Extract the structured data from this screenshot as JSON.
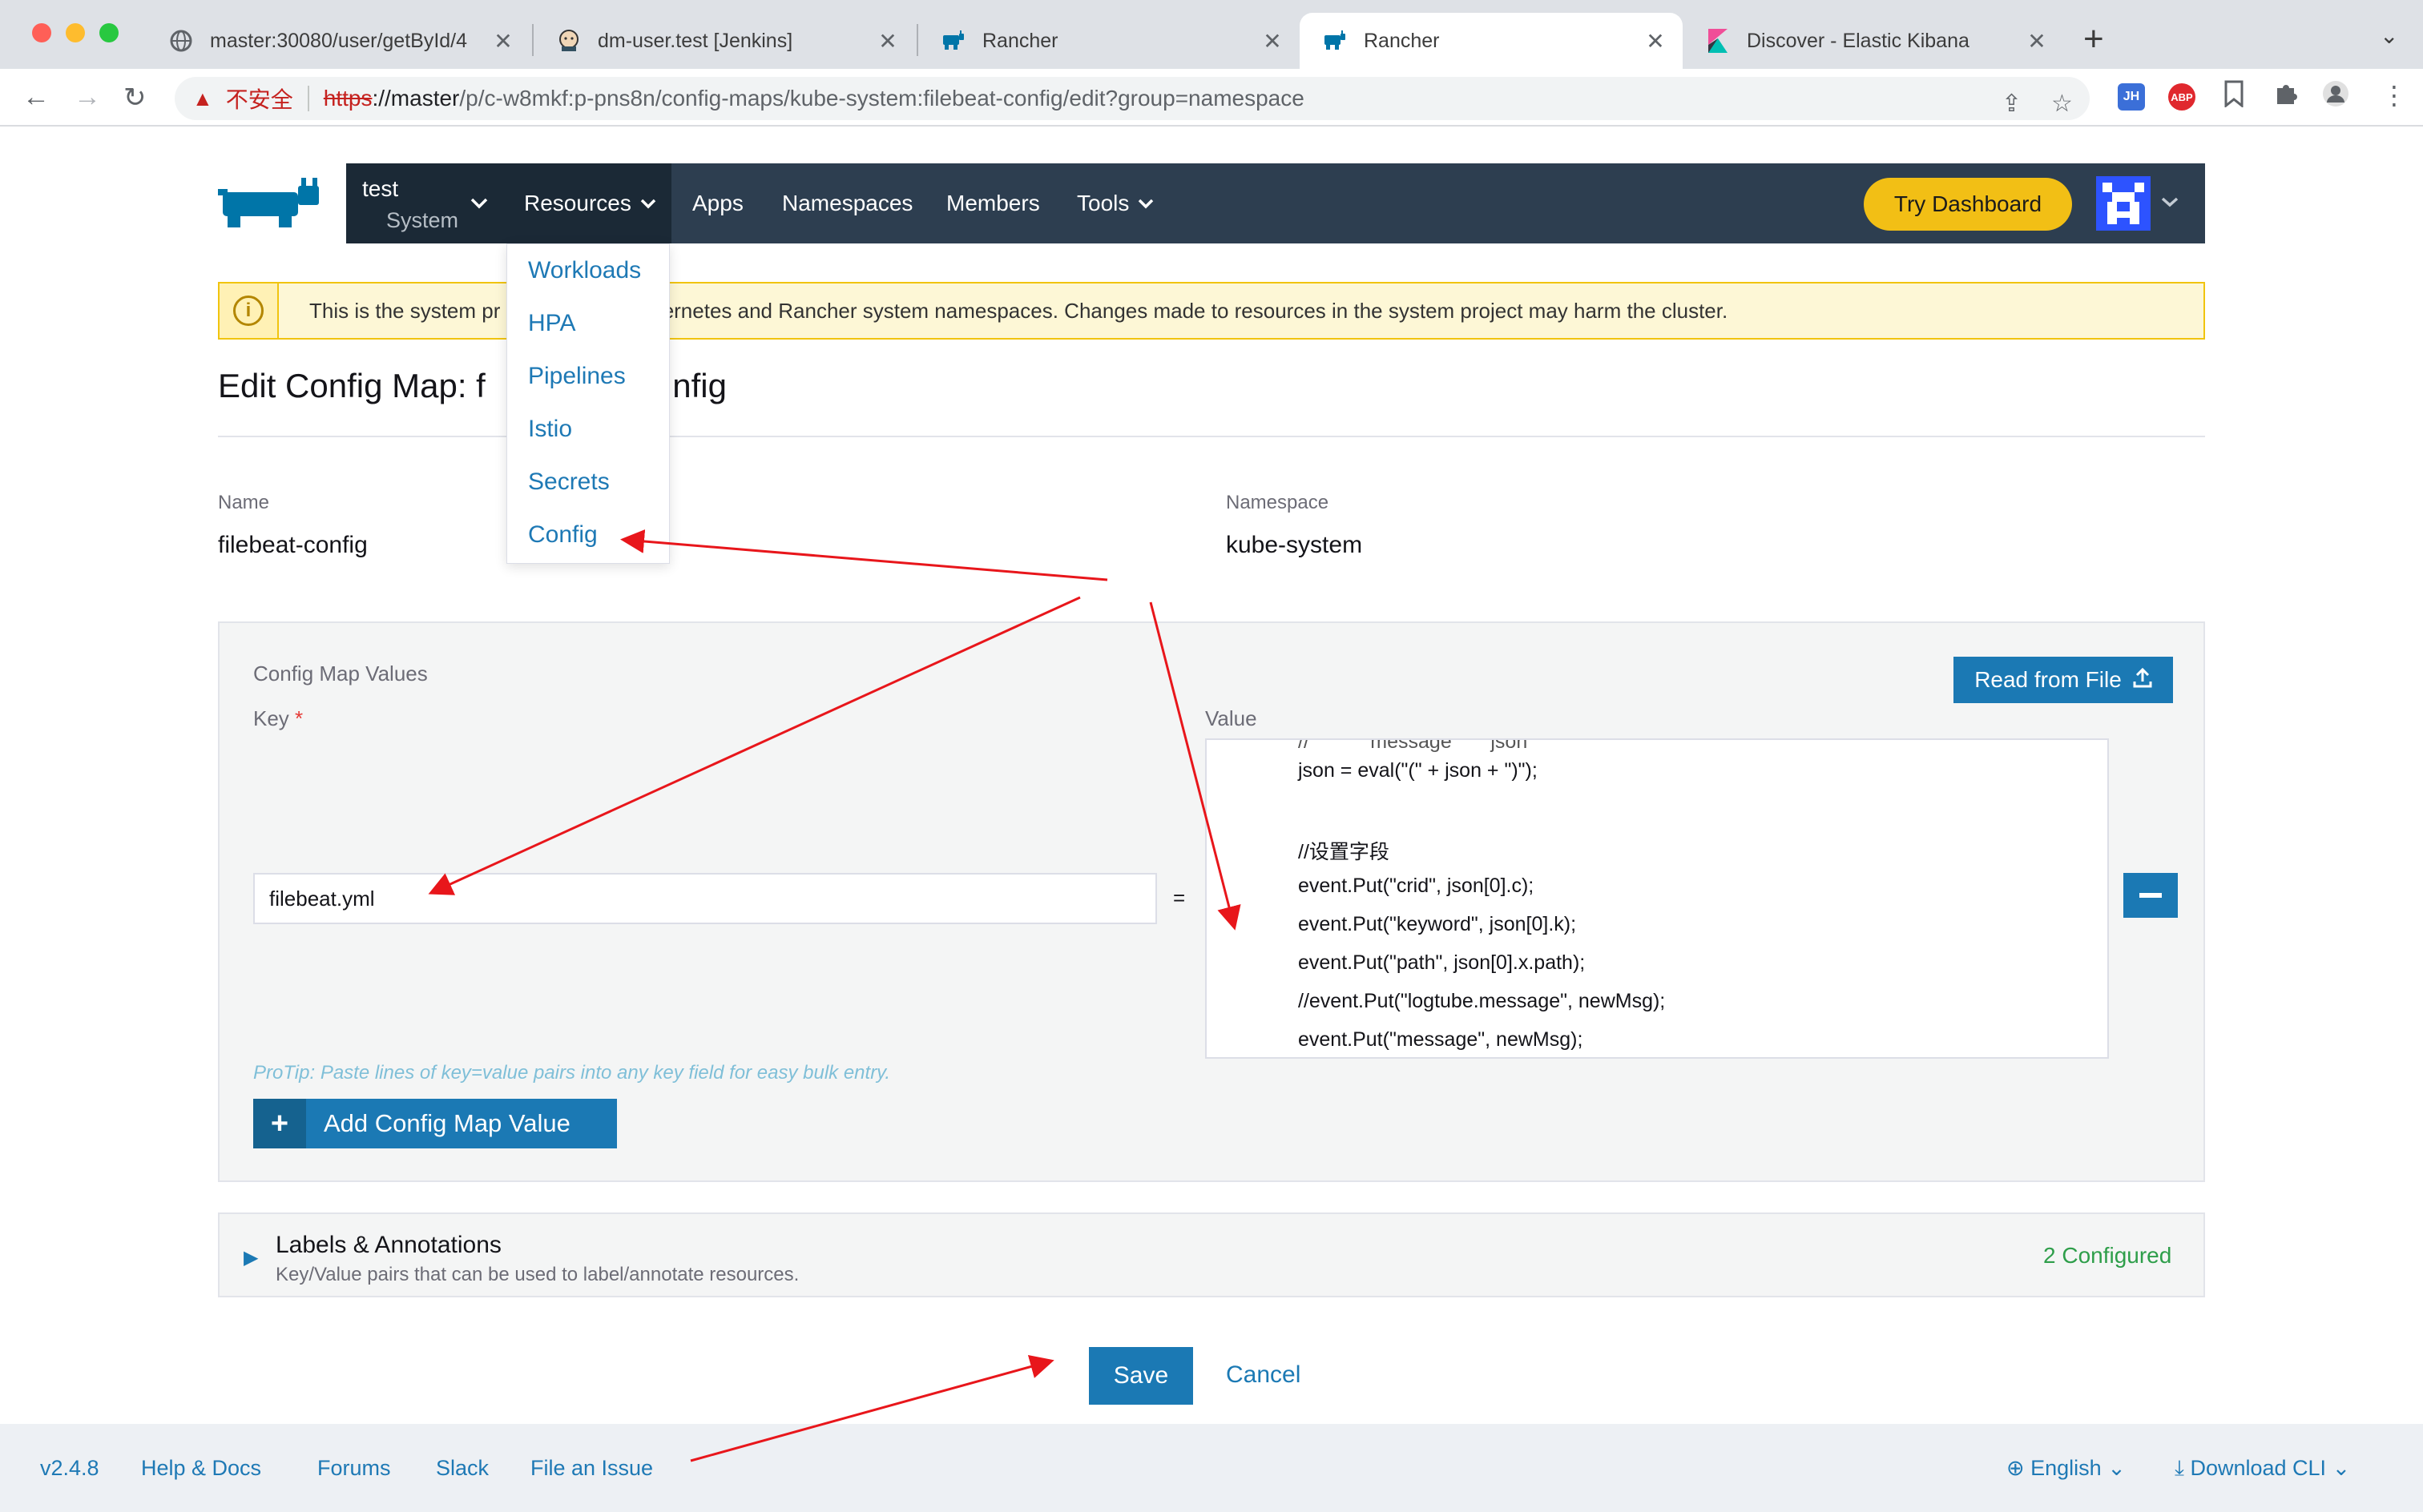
{
  "browser": {
    "tabs": [
      {
        "title": "master:30080/user/getById/4",
        "close": "✕",
        "favicon": "globe-icon"
      },
      {
        "title": "dm-user.test [Jenkins]",
        "close": "✕",
        "favicon": "jenkins-icon"
      },
      {
        "title": "Rancher",
        "close": "✕",
        "favicon": "rancher-icon"
      },
      {
        "title": "Rancher",
        "close": "✕",
        "favicon": "rancher-icon",
        "active": true
      },
      {
        "title": "Discover - Elastic Kibana",
        "close": "✕",
        "favicon": "kibana-icon"
      }
    ],
    "new_tab": "+",
    "tab_menu": "⌄",
    "address": {
      "security_label": "不安全",
      "scheme": "https",
      "host": "://master",
      "path": "/p/c-w8mkf:p-pns8n/config-maps/kube-system:filebeat-config/edit?group=namespace"
    },
    "extensions": {
      "jh": "JH",
      "abp": "ABP"
    }
  },
  "header": {
    "project_name": "test",
    "project_sub": "System",
    "nav": {
      "resources": "Resources",
      "apps": "Apps",
      "namespaces": "Namespaces",
      "members": "Members",
      "tools": "Tools"
    },
    "try_dashboard": "Try Dashboard"
  },
  "resources_menu": [
    "Workloads",
    "HPA",
    "Pipelines",
    "Istio",
    "Secrets",
    "Config"
  ],
  "banner": {
    "text": "This is the system pr                 all Kubernetes and Rancher system namespaces. Changes made to resources in the system project may harm the cluster."
  },
  "page": {
    "title": "Edit Config Map: f                    nfig"
  },
  "form": {
    "name_label": "Name",
    "name_value": "filebeat-config",
    "namespace_label": "Namespace",
    "namespace_value": "kube-system"
  },
  "config_values": {
    "title": "Config Map Values",
    "key_label": "Key",
    "required_mark": "*",
    "value_label": "Value",
    "read_from_file": "Read from File",
    "key_value": "filebeat.yml",
    "equals": "=",
    "value_lines": [
      "json = eval(\"(\" + json + \")\");",
      "",
      "//设置字段",
      "event.Put(\"crid\", json[0].c);",
      "event.Put(\"keyword\", json[0].k);",
      "event.Put(\"path\", json[0].x.path);",
      "//event.Put(\"logtube.message\", newMsg);",
      "event.Put(\"message\", newMsg);"
    ],
    "protip": "ProTip: Paste lines of key=value pairs into any key field for easy bulk entry.",
    "add_button": "Add Config Map Value"
  },
  "labels": {
    "title": "Labels & Annotations",
    "subtitle": "Key/Value pairs that can be used to label/annotate resources.",
    "count": "2 Configured"
  },
  "actions": {
    "save": "Save",
    "cancel": "Cancel"
  },
  "footer": {
    "version": "v2.4.8",
    "help": "Help & Docs",
    "forums": "Forums",
    "slack": "Slack",
    "issue": "File an Issue",
    "language": "English",
    "download": "Download CLI"
  },
  "colors": {
    "nav_bg": "#2d3e50",
    "accent": "#1b79b4",
    "try_dashboard": "#f2bf15",
    "annotation_arrow": "#e8161b"
  }
}
